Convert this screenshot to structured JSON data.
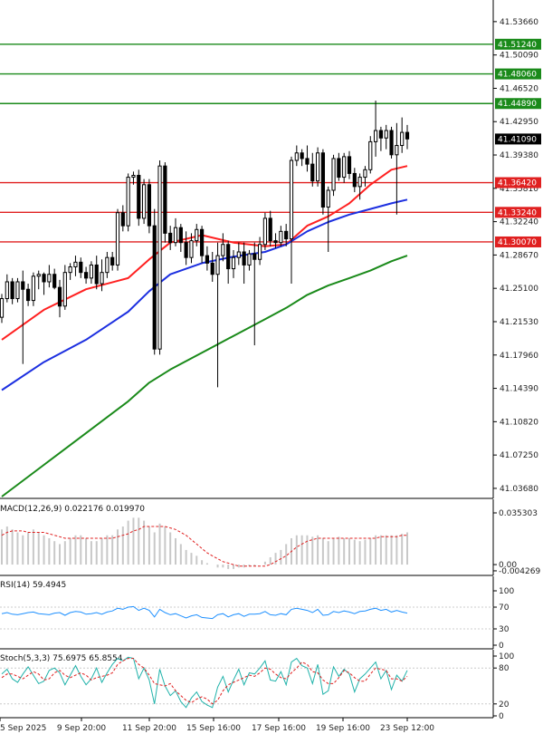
{
  "chart_data": {
    "type": "candlestick",
    "price_axis": {
      "ticks": [
        "41.53660",
        "41.50090",
        "41.46520",
        "41.42950",
        "41.39380",
        "41.35810",
        "41.32240",
        "41.28670",
        "41.25100",
        "41.21530",
        "41.17960",
        "41.14390",
        "41.10820",
        "41.07250",
        "41.03680"
      ],
      "range": [
        41.028,
        41.552
      ]
    },
    "time_axis": {
      "ticks": [
        "5 Sep 2025",
        "9 Sep 20:00",
        "11 Sep 20:00",
        "15 Sep 16:00",
        "17 Sep 16:00",
        "19 Sep 16:00",
        "23 Sep 12:00"
      ]
    },
    "levels": [
      {
        "label": "41.51240",
        "value": 41.5124,
        "color": "#1a8a1a"
      },
      {
        "label": "41.48060",
        "value": 41.4806,
        "color": "#1a8a1a"
      },
      {
        "label": "41.44890",
        "value": 41.4489,
        "color": "#1a8a1a"
      },
      {
        "label": "41.36420",
        "value": 41.3642,
        "color": "#e02020"
      },
      {
        "label": "41.33240",
        "value": 41.3324,
        "color": "#e02020"
      },
      {
        "label": "41.30070",
        "value": 41.3007,
        "color": "#e02020"
      }
    ],
    "current_price": {
      "label": "41.41090",
      "value": 41.4109
    },
    "candles": [
      [
        41.22,
        41.245,
        41.214,
        41.24
      ],
      [
        41.24,
        41.266,
        41.236,
        41.258
      ],
      [
        41.258,
        41.262,
        41.234,
        41.24
      ],
      [
        41.24,
        41.262,
        41.236,
        41.258
      ],
      [
        41.258,
        41.27,
        41.17,
        41.25
      ],
      [
        41.25,
        41.256,
        41.232,
        41.238
      ],
      [
        41.238,
        41.268,
        41.232,
        41.264
      ],
      [
        41.264,
        41.27,
        41.25,
        41.266
      ],
      [
        41.266,
        41.268,
        41.244,
        41.258
      ],
      [
        41.258,
        41.276,
        41.252,
        41.266
      ],
      [
        41.266,
        41.272,
        41.25,
        41.252
      ],
      [
        41.252,
        41.26,
        41.22,
        41.232
      ],
      [
        41.232,
        41.276,
        41.228,
        41.268
      ],
      [
        41.268,
        41.278,
        41.26,
        41.274
      ],
      [
        41.274,
        41.286,
        41.264,
        41.279
      ],
      [
        41.279,
        41.284,
        41.262,
        41.268
      ],
      [
        41.268,
        41.274,
        41.256,
        41.262
      ],
      [
        41.262,
        41.28,
        41.256,
        41.276
      ],
      [
        41.276,
        41.286,
        41.25,
        41.256
      ],
      [
        41.256,
        41.282,
        41.248,
        41.268
      ],
      [
        41.268,
        41.29,
        41.262,
        41.284
      ],
      [
        41.284,
        41.29,
        41.27,
        41.276
      ],
      [
        41.276,
        41.336,
        41.27,
        41.332
      ],
      [
        41.332,
        41.34,
        41.312,
        41.318
      ],
      [
        41.318,
        41.374,
        41.312,
        41.37
      ],
      [
        41.37,
        41.376,
        41.362,
        41.372
      ],
      [
        41.372,
        41.378,
        41.318,
        41.326
      ],
      [
        41.326,
        41.368,
        41.32,
        41.362
      ],
      [
        41.362,
        41.368,
        41.31,
        41.318
      ],
      [
        41.318,
        41.336,
        41.18,
        41.186
      ],
      [
        41.186,
        41.388,
        41.18,
        41.382
      ],
      [
        41.382,
        41.386,
        41.3,
        41.31
      ],
      [
        41.31,
        41.318,
        41.292,
        41.3
      ],
      [
        41.3,
        41.326,
        41.296,
        41.316
      ],
      [
        41.316,
        41.32,
        41.29,
        41.3
      ],
      [
        41.3,
        41.312,
        41.276,
        41.284
      ],
      [
        41.284,
        41.31,
        41.278,
        41.302
      ],
      [
        41.302,
        41.32,
        41.296,
        41.314
      ],
      [
        41.314,
        41.318,
        41.278,
        41.286
      ],
      [
        41.286,
        41.296,
        41.27,
        41.278
      ],
      [
        41.278,
        41.29,
        41.258,
        41.266
      ],
      [
        41.266,
        41.3,
        41.145,
        41.286
      ],
      [
        41.286,
        41.31,
        41.28,
        41.298
      ],
      [
        41.298,
        41.302,
        41.256,
        41.272
      ],
      [
        41.272,
        41.292,
        41.262,
        41.284
      ],
      [
        41.284,
        41.3,
        41.276,
        41.29
      ],
      [
        41.29,
        41.3,
        41.256,
        41.276
      ],
      [
        41.276,
        41.292,
        41.27,
        41.288
      ],
      [
        41.288,
        41.3,
        41.19,
        41.282
      ],
      [
        41.282,
        41.306,
        41.276,
        41.298
      ],
      [
        41.298,
        41.332,
        41.292,
        41.326
      ],
      [
        41.326,
        41.334,
        41.296,
        41.302
      ],
      [
        41.302,
        41.31,
        41.294,
        41.3
      ],
      [
        41.3,
        41.318,
        41.296,
        41.312
      ],
      [
        41.312,
        41.32,
        41.296,
        41.304
      ],
      [
        41.304,
        41.392,
        41.256,
        41.388
      ],
      [
        41.388,
        41.404,
        41.382,
        41.396
      ],
      [
        41.396,
        41.4,
        41.382,
        41.39
      ],
      [
        41.39,
        41.404,
        41.376,
        41.384
      ],
      [
        41.384,
        41.396,
        41.36,
        41.366
      ],
      [
        41.366,
        41.402,
        41.36,
        41.396
      ],
      [
        41.396,
        41.4,
        41.33,
        41.338
      ],
      [
        41.338,
        41.36,
        41.29,
        41.356
      ],
      [
        41.356,
        41.394,
        41.35,
        41.39
      ],
      [
        41.39,
        41.396,
        41.366,
        41.37
      ],
      [
        41.37,
        41.396,
        41.364,
        41.392
      ],
      [
        41.392,
        41.398,
        41.368,
        41.374
      ],
      [
        41.374,
        41.38,
        41.354,
        41.36
      ],
      [
        41.36,
        41.374,
        41.346,
        41.37
      ],
      [
        41.37,
        41.382,
        41.36,
        41.378
      ],
      [
        41.378,
        41.414,
        41.374,
        41.408
      ],
      [
        41.408,
        41.452,
        41.392,
        41.42
      ],
      [
        41.42,
        41.424,
        41.398,
        41.412
      ],
      [
        41.412,
        41.426,
        41.4,
        41.42
      ],
      [
        41.42,
        41.424,
        41.39,
        41.394
      ],
      [
        41.394,
        41.428,
        41.33,
        41.404
      ],
      [
        41.404,
        41.434,
        41.396,
        41.418
      ],
      [
        41.418,
        41.426,
        41.4,
        41.411
      ]
    ],
    "moving_averages": [
      {
        "color": "#ff2020",
        "values": [
          [
            0,
            41.196
          ],
          [
            8,
            41.228
          ],
          [
            16,
            41.25
          ],
          [
            24,
            41.262
          ],
          [
            28,
            41.282
          ],
          [
            32,
            41.3
          ],
          [
            38,
            41.308
          ],
          [
            44,
            41.3
          ],
          [
            50,
            41.296
          ],
          [
            54,
            41.298
          ],
          [
            58,
            41.318
          ],
          [
            62,
            41.328
          ],
          [
            66,
            41.342
          ],
          [
            70,
            41.362
          ],
          [
            74,
            41.378
          ],
          [
            77,
            41.382
          ]
        ]
      },
      {
        "color": "#1c2fe0",
        "values": [
          [
            0,
            41.142
          ],
          [
            8,
            41.172
          ],
          [
            16,
            41.196
          ],
          [
            24,
            41.226
          ],
          [
            28,
            41.248
          ],
          [
            32,
            41.266
          ],
          [
            38,
            41.278
          ],
          [
            44,
            41.285
          ],
          [
            50,
            41.29
          ],
          [
            54,
            41.298
          ],
          [
            58,
            41.312
          ],
          [
            62,
            41.322
          ],
          [
            66,
            41.33
          ],
          [
            70,
            41.336
          ],
          [
            74,
            41.342
          ],
          [
            77,
            41.346
          ]
        ]
      },
      {
        "color": "#1a8a1a",
        "values": [
          [
            0,
            41.028
          ],
          [
            8,
            41.062
          ],
          [
            16,
            41.096
          ],
          [
            24,
            41.13
          ],
          [
            28,
            41.15
          ],
          [
            32,
            41.164
          ],
          [
            38,
            41.182
          ],
          [
            44,
            41.2
          ],
          [
            50,
            41.218
          ],
          [
            54,
            41.23
          ],
          [
            58,
            41.244
          ],
          [
            62,
            41.254
          ],
          [
            66,
            41.262
          ],
          [
            70,
            41.27
          ],
          [
            74,
            41.28
          ],
          [
            77,
            41.286
          ]
        ]
      }
    ],
    "macd": {
      "label": "MACD(12,26,9) 0.022176 0.019970",
      "ticks": [
        "0.035303",
        "0.00",
        "-0.004269"
      ],
      "range": [
        -0.0043,
        0.0353
      ],
      "hist": [
        0.024,
        0.026,
        0.024,
        0.022,
        0.02,
        0.022,
        0.024,
        0.022,
        0.02,
        0.018,
        0.016,
        0.014,
        0.016,
        0.018,
        0.02,
        0.02,
        0.018,
        0.016,
        0.016,
        0.018,
        0.02,
        0.02,
        0.024,
        0.026,
        0.03,
        0.032,
        0.032,
        0.03,
        0.026,
        0.022,
        0.028,
        0.026,
        0.022,
        0.018,
        0.014,
        0.01,
        0.008,
        0.006,
        0.003,
        0.001,
        0.0,
        -0.002,
        -0.002,
        -0.003,
        -0.003,
        -0.002,
        -0.002,
        -0.001,
        -0.001,
        0.0,
        0.002,
        0.005,
        0.008,
        0.01,
        0.014,
        0.018,
        0.02,
        0.02,
        0.02,
        0.019,
        0.02,
        0.018,
        0.016,
        0.018,
        0.019,
        0.018,
        0.018,
        0.017,
        0.016,
        0.017,
        0.018,
        0.02,
        0.02,
        0.02,
        0.02,
        0.02,
        0.021,
        0.022
      ],
      "signal": [
        0.02,
        0.022,
        0.023,
        0.023,
        0.023,
        0.022,
        0.022,
        0.022,
        0.022,
        0.021,
        0.02,
        0.019,
        0.018,
        0.018,
        0.018,
        0.018,
        0.018,
        0.018,
        0.018,
        0.018,
        0.018,
        0.018,
        0.019,
        0.02,
        0.021,
        0.023,
        0.024,
        0.026,
        0.026,
        0.026,
        0.026,
        0.026,
        0.025,
        0.024,
        0.022,
        0.02,
        0.017,
        0.014,
        0.011,
        0.008,
        0.006,
        0.004,
        0.002,
        0.001,
        0.0,
        -0.001,
        -0.001,
        -0.001,
        -0.001,
        -0.001,
        -0.001,
        0.0,
        0.002,
        0.004,
        0.006,
        0.009,
        0.012,
        0.014,
        0.016,
        0.017,
        0.018,
        0.018,
        0.018,
        0.018,
        0.018,
        0.018,
        0.018,
        0.018,
        0.018,
        0.018,
        0.018,
        0.018,
        0.019,
        0.019,
        0.019,
        0.019,
        0.02,
        0.02
      ]
    },
    "rsi": {
      "label": "RSI(14) 59.4945",
      "ticks": [
        "100",
        "70",
        "30",
        "0"
      ],
      "values": [
        58,
        60,
        57,
        56,
        58,
        60,
        61,
        58,
        57,
        56,
        59,
        60,
        55,
        60,
        62,
        61,
        57,
        58,
        60,
        57,
        61,
        63,
        68,
        66,
        70,
        71,
        64,
        68,
        64,
        52,
        66,
        60,
        56,
        58,
        54,
        50,
        54,
        56,
        51,
        50,
        49,
        56,
        58,
        52,
        56,
        58,
        53,
        57,
        57,
        58,
        62,
        56,
        55,
        58,
        56,
        66,
        68,
        66,
        64,
        60,
        66,
        55,
        56,
        62,
        60,
        63,
        61,
        58,
        62,
        63,
        66,
        68,
        64,
        66,
        61,
        64,
        61,
        59
      ]
    },
    "stoch": {
      "label": "Stoch(5,3,3) 75.6975 65.8554",
      "ticks": [
        "100",
        "80",
        "20",
        "0"
      ],
      "k": [
        70,
        78,
        62,
        56,
        70,
        82,
        68,
        54,
        58,
        76,
        80,
        72,
        52,
        68,
        84,
        66,
        52,
        62,
        80,
        56,
        72,
        86,
        96,
        92,
        98,
        96,
        62,
        80,
        60,
        20,
        78,
        50,
        34,
        42,
        24,
        14,
        30,
        40,
        24,
        18,
        14,
        48,
        66,
        40,
        60,
        78,
        52,
        72,
        70,
        80,
        92,
        60,
        58,
        74,
        52,
        90,
        96,
        84,
        80,
        54,
        86,
        36,
        42,
        82,
        66,
        78,
        70,
        40,
        62,
        70,
        80,
        90,
        62,
        76,
        44,
        68,
        58,
        76
      ],
      "d": [
        64,
        70,
        70,
        66,
        62,
        68,
        74,
        70,
        60,
        62,
        72,
        76,
        68,
        64,
        68,
        72,
        68,
        60,
        64,
        66,
        68,
        72,
        86,
        92,
        96,
        96,
        86,
        80,
        68,
        54,
        52,
        50,
        54,
        42,
        34,
        26,
        22,
        28,
        32,
        28,
        20,
        26,
        42,
        52,
        56,
        60,
        64,
        68,
        66,
        72,
        80,
        78,
        70,
        64,
        62,
        72,
        80,
        90,
        86,
        74,
        72,
        60,
        54,
        54,
        64,
        76,
        72,
        64,
        58,
        58,
        70,
        80,
        78,
        76,
        62,
        62,
        58,
        66
      ]
    }
  }
}
